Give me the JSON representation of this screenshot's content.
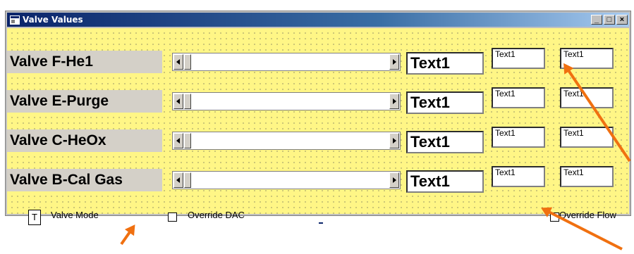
{
  "window": {
    "title": "Valve Values",
    "controls": [
      "_",
      "□",
      "×"
    ]
  },
  "rows": [
    {
      "label": "Valve F-He1",
      "big": "Text1",
      "small1": "Text1",
      "small2": "Text1"
    },
    {
      "label": "Valve E-Purge",
      "big": "Text1",
      "small1": "Text1",
      "small2": "Text1"
    },
    {
      "label": "Valve C-HeOx",
      "big": "Text1",
      "small1": "Text1",
      "small2": "Text1"
    },
    {
      "label": "Valve B-Cal Gas",
      "big": "Text1",
      "small1": "Text1",
      "small2": "Text1"
    }
  ],
  "bottom": {
    "mode_box": "T",
    "valve_mode": "Valve Mode",
    "override_dac": "Override DAC",
    "override_flow": "Override Flow"
  },
  "colors": {
    "client_bg": "#fff686",
    "title_start": "#0a246a",
    "annotation_arrow": "#f07010"
  }
}
